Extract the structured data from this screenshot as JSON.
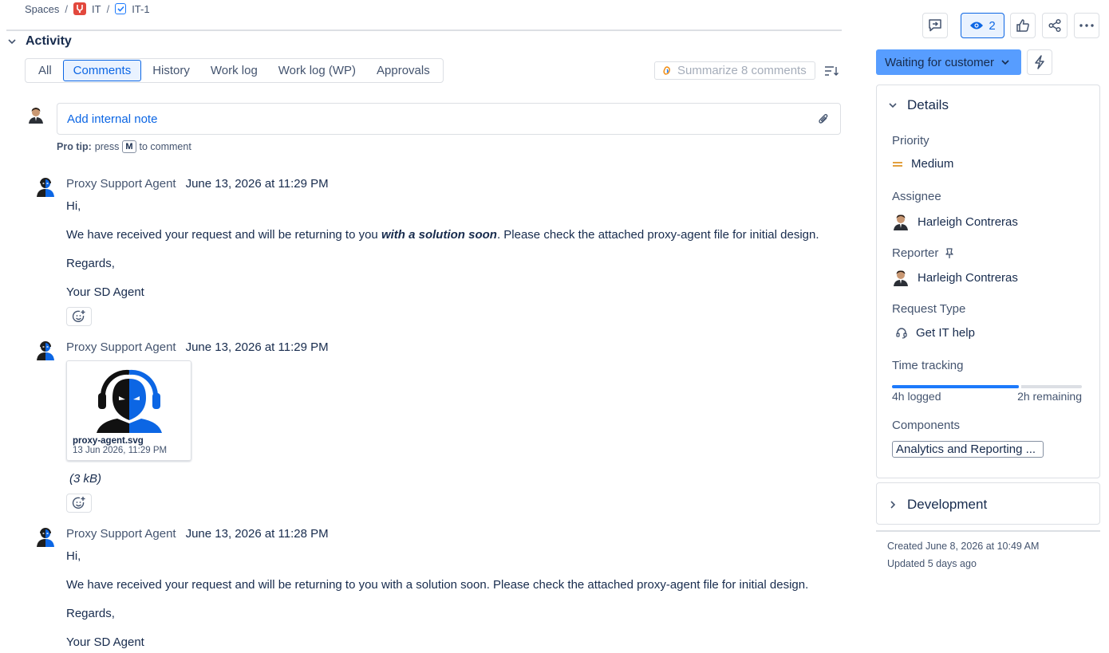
{
  "breadcrumb": {
    "spaces": "Spaces",
    "project": "IT",
    "issue": "IT-1"
  },
  "activity": {
    "title": "Activity",
    "tabs": [
      "All",
      "Comments",
      "History",
      "Work log",
      "Work log (WP)",
      "Approvals"
    ],
    "active_tab": "Comments",
    "summarize_label": "Summarize 8 comments"
  },
  "composer": {
    "placeholder": "Add internal note",
    "protip_bold": "Pro tip:",
    "protip_press": "press",
    "protip_key": "M",
    "protip_rest": "to comment"
  },
  "comments": [
    {
      "author": "Proxy Support Agent",
      "time": "June 13, 2026 at 11:29 PM",
      "greeting": "Hi,",
      "body_before": "We have received your request and will be returning to you ",
      "body_emph": "with a solution soon",
      "body_after": ".  Please check the attached proxy-agent file for initial design.",
      "regards": "Regards,",
      "signature": "Your SD Agent"
    },
    {
      "author": "Proxy Support Agent",
      "time": "June 13, 2026 at 11:29 PM",
      "attachment": {
        "name": "proxy-agent.svg",
        "date": "13 Jun 2026, 11:29 PM",
        "size": "(3 kB)"
      }
    },
    {
      "author": "Proxy Support Agent",
      "time": "June 13, 2026 at 11:28 PM",
      "greeting": "Hi,",
      "body": "We have received your request and will be returning to you with a solution soon.  Please check the attached proxy-agent file for initial design.",
      "regards": "Regards,",
      "signature": "Your SD Agent"
    }
  ],
  "toolbar": {
    "watch_count": "2"
  },
  "status": {
    "label": "Waiting for customer",
    "color": "#579dff"
  },
  "details": {
    "title": "Details",
    "priority_label": "Priority",
    "priority_value": "Medium",
    "assignee_label": "Assignee",
    "assignee_value": "Harleigh Contreras",
    "reporter_label": "Reporter",
    "reporter_value": "Harleigh Contreras",
    "request_type_label": "Request Type",
    "request_type_value": "Get IT help",
    "time_tracking_label": "Time tracking",
    "time_logged": "4h logged",
    "time_remaining": "2h remaining",
    "time_logged_fraction": 0.67,
    "components_label": "Components",
    "component_value": "Analytics and Reporting ..."
  },
  "development": {
    "title": "Development"
  },
  "meta": {
    "created": "Created June 8, 2026 at 10:49 AM",
    "updated": "Updated 5 days ago"
  }
}
